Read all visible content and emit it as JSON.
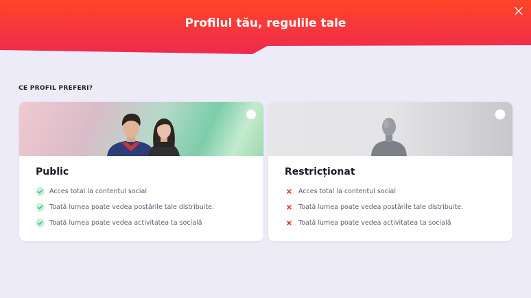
{
  "header": {
    "title": "Profilul tău, regulile tale",
    "gradient_start": "#ff4527",
    "gradient_end": "#ee2a4f"
  },
  "close_icon": "close-icon",
  "section_label": "CE PROFIL PREFERI?",
  "cards": [
    {
      "id": "public",
      "title": "Public",
      "mark_icon": "check-icon",
      "mark_color": "#3fb66a",
      "selected": false,
      "features": [
        "Acces total la contentul social",
        "Toată lumea poate vedea postările tale distribuite.",
        "Toată lumea poate vedea activitatea ta socială"
      ]
    },
    {
      "id": "restricted",
      "title": "Restricționat",
      "mark_icon": "cross-icon",
      "mark_color": "#e53935",
      "selected": false,
      "features": [
        "Acces total la contentul social",
        "Toată lumea poate vedea postările tale distribuite.",
        "Toată lumea poate vedea activitatea ta socială"
      ]
    }
  ]
}
